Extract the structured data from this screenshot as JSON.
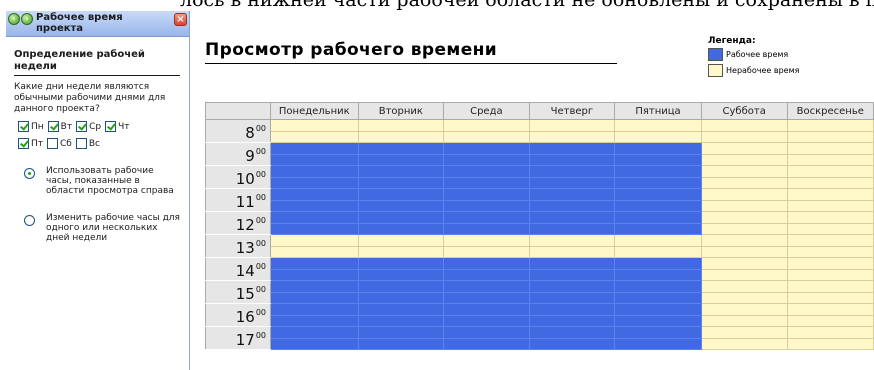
{
  "top_text": "лось в нижней части рабочей области не обновлены и сохранены в поле.",
  "task_pane": {
    "title": "Рабочее время проекта",
    "section_title": "Определение рабочей недели",
    "question": "Какие дни недели являются обычными рабочими днями для данного проекта?",
    "days": [
      {
        "label": "Пн",
        "checked": true
      },
      {
        "label": "Вт",
        "checked": true
      },
      {
        "label": "Ср",
        "checked": true
      },
      {
        "label": "Чт",
        "checked": true
      },
      {
        "label": "Пт",
        "checked": true
      },
      {
        "label": "Сб",
        "checked": false
      },
      {
        "label": "Вс",
        "checked": false
      }
    ],
    "options": [
      {
        "label": "Использовать рабочие часы, показанные в области просмотра справа",
        "selected": true
      },
      {
        "label": "Изменить рабочие часы для одного или нескольких дней недели",
        "selected": false
      }
    ]
  },
  "main": {
    "title": "Просмотр рабочего времени",
    "legend": {
      "title": "Легенда:",
      "items": [
        {
          "label": "Рабочее время",
          "color": "#4169e1"
        },
        {
          "label": "Нерабочее время",
          "color": "#fff8c9"
        }
      ]
    },
    "columns": [
      "Понедельник",
      "Вторник",
      "Среда",
      "Четверг",
      "Пятница",
      "Суббота",
      "Воскресенье"
    ],
    "hours": [
      "8",
      "9",
      "10",
      "11",
      "12",
      "13",
      "14",
      "15",
      "16",
      "17"
    ],
    "minutes": "00",
    "schedule": [
      [
        false,
        false,
        false,
        false,
        false,
        false,
        false
      ],
      [
        true,
        true,
        true,
        true,
        true,
        false,
        false
      ],
      [
        true,
        true,
        true,
        true,
        true,
        false,
        false
      ],
      [
        true,
        true,
        true,
        true,
        true,
        false,
        false
      ],
      [
        true,
        true,
        true,
        true,
        true,
        false,
        false
      ],
      [
        false,
        false,
        false,
        false,
        false,
        false,
        false
      ],
      [
        true,
        true,
        true,
        true,
        true,
        false,
        false
      ],
      [
        true,
        true,
        true,
        true,
        true,
        false,
        false
      ],
      [
        true,
        true,
        true,
        true,
        true,
        false,
        false
      ],
      [
        true,
        true,
        true,
        true,
        true,
        false,
        false
      ]
    ]
  }
}
